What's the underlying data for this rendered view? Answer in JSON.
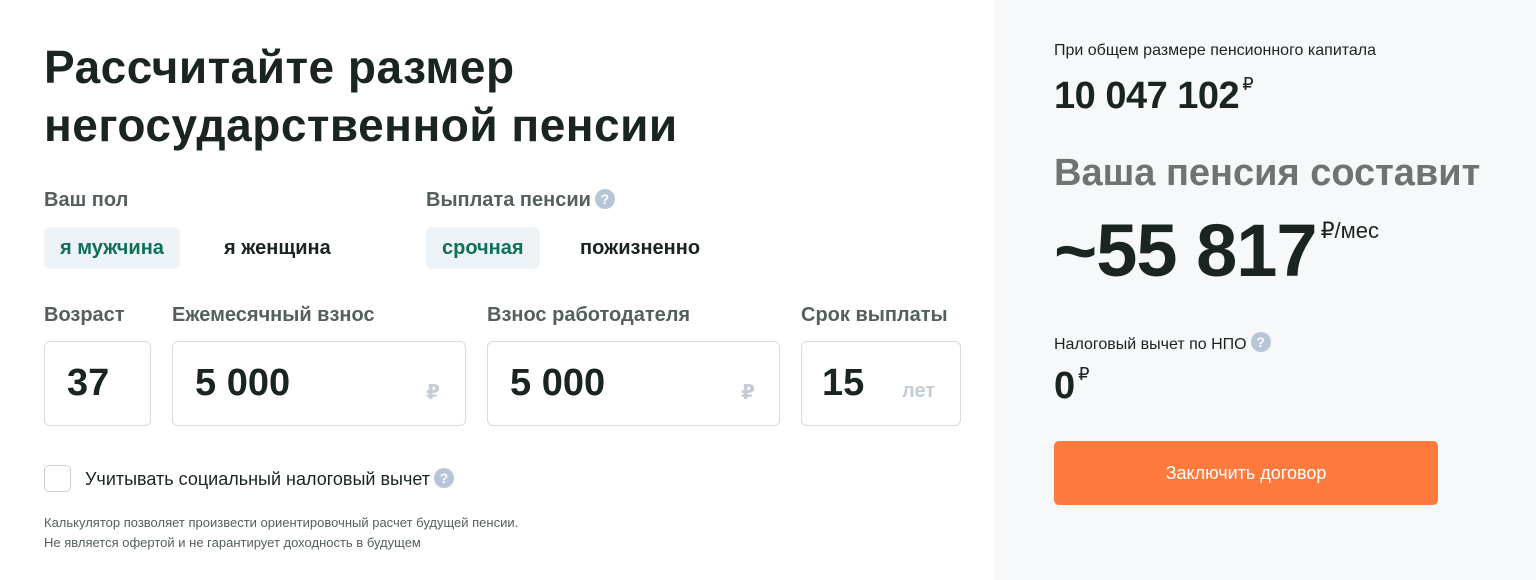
{
  "calculator": {
    "title_line1": "Рассчитайте размер",
    "title_line2": "негосударственной пенсии",
    "gender": {
      "label": "Ваш пол",
      "options": [
        "я мужчина",
        "я женщина"
      ],
      "selected": "я мужчина"
    },
    "payout_type": {
      "label": "Выплата пенсии",
      "help": "?",
      "options": [
        "срочная",
        "пожизненно"
      ],
      "selected": "срочная"
    },
    "fields": {
      "age": {
        "label": "Возраст",
        "value": "37"
      },
      "monthly": {
        "label": "Ежемесячный взнос",
        "value": "5 000",
        "unit": "₽"
      },
      "employer": {
        "label": "Взнос работодателя",
        "value": "5 000",
        "unit": "₽"
      },
      "term": {
        "label": "Срок выплаты",
        "value": "15",
        "unit": "лет"
      }
    },
    "tax_checkbox": {
      "label": "Учитывать социальный налоговый вычет",
      "checked": false,
      "help": "?"
    },
    "note_line1": "Калькулятор позволяет произвести ориентировочный расчет будущей пенсии.",
    "note_line2": "Не является офертой и не гарантирует доходность в будущем"
  },
  "result": {
    "capital_label": "При общем размере пенсионного капитала",
    "capital_value": "10 047 102",
    "capital_currency": "₽",
    "pension_heading": "Ваша пенсия составит",
    "pension_value": "~55 817",
    "pension_unit": "₽/мес",
    "tax_label": "Налоговый вычет по НПО",
    "tax_help": "?",
    "tax_value": "0",
    "tax_currency": "₽",
    "cta_label": "Заключить договор"
  },
  "colors": {
    "accent": "#ff7a3d",
    "active_text": "#0f6f5b",
    "active_bg": "#edf2f7",
    "panel_bg": "#f7f8fa"
  }
}
